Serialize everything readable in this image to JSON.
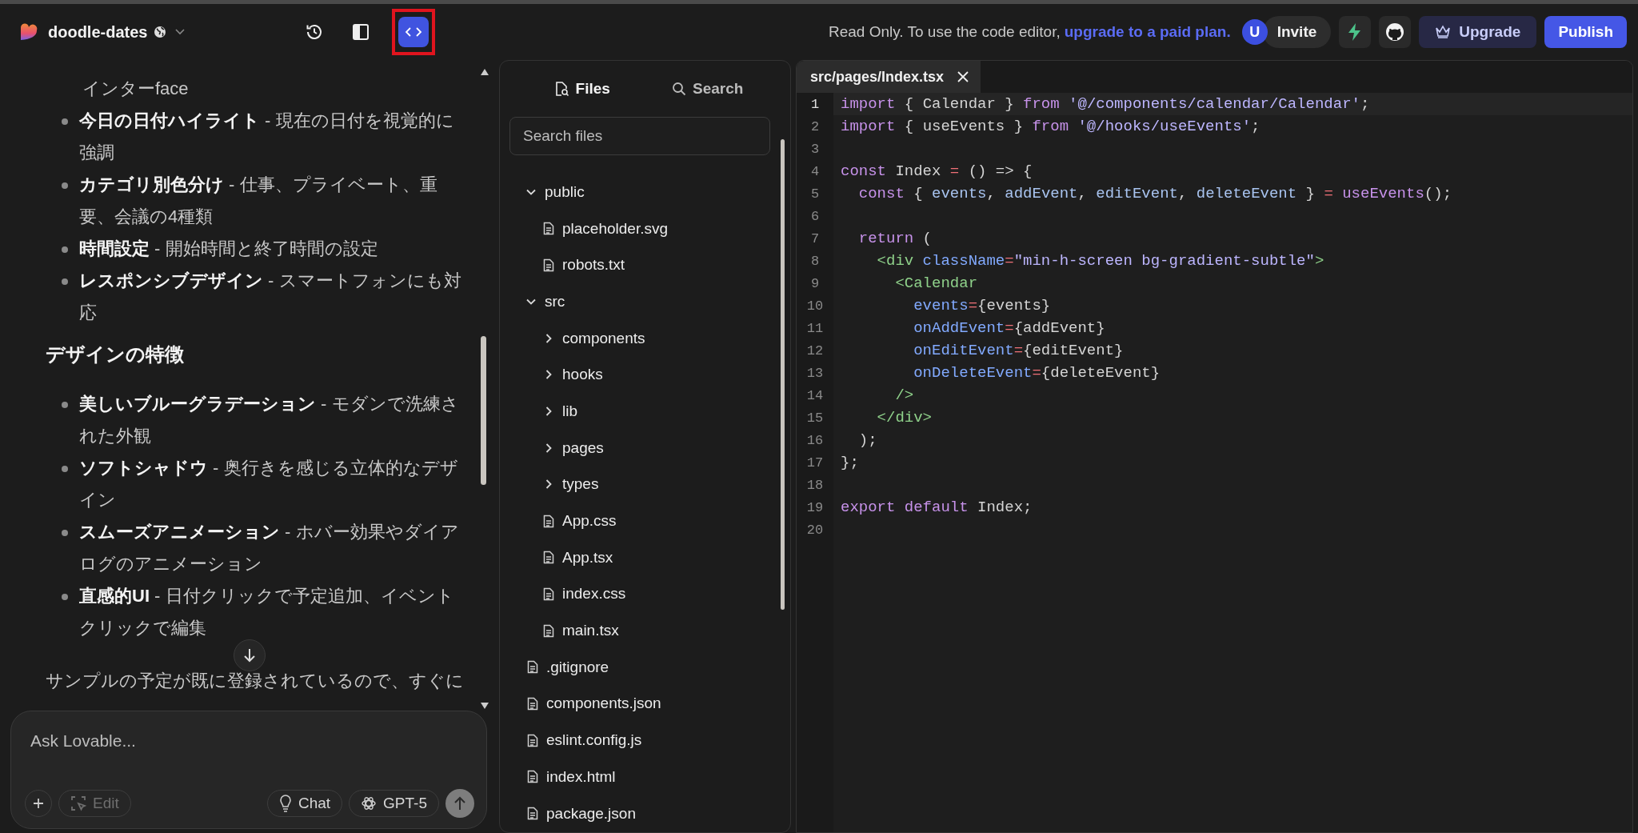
{
  "project": {
    "name": "doodle-dates"
  },
  "view_buttons": [
    {
      "kind": "history",
      "selected": false,
      "highlighted": false
    },
    {
      "kind": "sidebar",
      "selected": false,
      "highlighted": false
    },
    {
      "kind": "code",
      "selected": true,
      "highlighted": true
    }
  ],
  "notice": {
    "text": "Read Only. To use the code editor,",
    "link": "upgrade to a paid plan."
  },
  "avatar": {
    "initial": "U"
  },
  "invite": "Invite",
  "upgrade": "Upgrade",
  "publish": "Publish",
  "chat": {
    "features": [
      {
        "text": "インターface",
        "kind": "continuation"
      },
      {
        "text": "**今日の日付ハイライト** - 現在の日付を視覚的に強調",
        "kind": "bullet"
      },
      {
        "text": "**カテゴリ別色分け** - 仕事、プライベート、重要、会議の4種類",
        "kind": "bullet"
      },
      {
        "text": "**時間設定** - 開始時間と終了時間の設定",
        "kind": "bullet"
      },
      {
        "text": "**レスポンシブデザイン** - スマートフォンにも対応",
        "kind": "bullet"
      }
    ],
    "heading": "デザインの特徴",
    "design": [
      {
        "text": "**美しいブルーグラデーション** - モダンで洗練された外観",
        "kind": "bullet"
      },
      {
        "text": "**ソフトシャドウ** - 奥行きを感じる立体的なデザイン",
        "kind": "bullet"
      },
      {
        "text": "**スムーズアニメーション** - ホバー効果やダイアログのアニメーション",
        "kind": "bullet"
      },
      {
        "text": "**直感的UI** - 日付クリックで予定追加、イベントクリックで編集",
        "kind": "bullet"
      }
    ],
    "paragraph": "サンプルの予定が既に登録されているので、すぐに"
  },
  "composer": {
    "placeholder": "Ask Lovable...",
    "edit": {
      "label": "Edit",
      "disabled": true
    },
    "mode": "Chat",
    "model": "GPT-5",
    "send_disabled": true
  },
  "files_panel": {
    "tabs": [
      {
        "label": "Files",
        "selected": true
      },
      {
        "label": "Search",
        "selected": false
      }
    ],
    "search": {
      "placeholder": "Search files"
    },
    "tree": [
      {
        "name": "public",
        "kind": "folder",
        "expanded": true,
        "children": [
          {
            "name": "placeholder.svg",
            "kind": "file"
          },
          {
            "name": "robots.txt",
            "kind": "file"
          }
        ]
      },
      {
        "name": "src",
        "kind": "folder",
        "expanded": true,
        "children": [
          {
            "name": "components",
            "kind": "folder",
            "expanded": false
          },
          {
            "name": "hooks",
            "kind": "folder",
            "expanded": false
          },
          {
            "name": "lib",
            "kind": "folder",
            "expanded": false
          },
          {
            "name": "pages",
            "kind": "folder",
            "expanded": false
          },
          {
            "name": "types",
            "kind": "folder",
            "expanded": false
          },
          {
            "name": "App.css",
            "kind": "file"
          },
          {
            "name": "App.tsx",
            "kind": "file"
          },
          {
            "name": "index.css",
            "kind": "file"
          },
          {
            "name": "main.tsx",
            "kind": "file"
          }
        ]
      },
      {
        "name": ".gitignore",
        "kind": "file"
      },
      {
        "name": "components.json",
        "kind": "file"
      },
      {
        "name": "eslint.config.js",
        "kind": "file"
      },
      {
        "name": "index.html",
        "kind": "file"
      },
      {
        "name": "package.json",
        "kind": "file"
      }
    ]
  },
  "editor": {
    "tab": "src/pages/Index.tsx",
    "lines": [
      {
        "number": "1",
        "current": true,
        "tokens": [
          {
            "text": "import",
            "kind": "kw"
          },
          {
            "text": " { Calendar } ",
            "kind": "plain"
          },
          {
            "text": "from",
            "kind": "kw"
          },
          {
            "text": " '@/components/calendar/Calendar'",
            "kind": "str"
          },
          {
            "text": ";",
            "kind": "plain"
          }
        ]
      },
      {
        "number": "2",
        "current": false,
        "tokens": [
          {
            "text": "import",
            "kind": "kw"
          },
          {
            "text": " { useEvents } ",
            "kind": "plain"
          },
          {
            "text": "from",
            "kind": "kw"
          },
          {
            "text": " '@/hooks/useEvents'",
            "kind": "str"
          },
          {
            "text": ";",
            "kind": "plain"
          }
        ]
      },
      {
        "number": "3",
        "current": false
      },
      {
        "number": "4",
        "current": false,
        "tokens": [
          {
            "text": "const",
            "kind": "kw"
          },
          {
            "text": " Index ",
            "kind": "plain"
          },
          {
            "text": "=",
            "kind": "op"
          },
          {
            "text": " () => {",
            "kind": "plain"
          }
        ]
      },
      {
        "number": "5",
        "current": false,
        "tokens": [
          {
            "text": "  const",
            "kind": "kw"
          },
          {
            "text": " { ",
            "kind": "plain"
          },
          {
            "text": "events",
            "kind": "var"
          },
          {
            "text": ", ",
            "kind": "plain"
          },
          {
            "text": "addEvent",
            "kind": "var"
          },
          {
            "text": ", ",
            "kind": "plain"
          },
          {
            "text": "editEvent",
            "kind": "var"
          },
          {
            "text": ", ",
            "kind": "plain"
          },
          {
            "text": "deleteEvent",
            "kind": "var"
          },
          {
            "text": " } ",
            "kind": "plain"
          },
          {
            "text": "=",
            "kind": "op"
          },
          {
            "text": " useEvents",
            "kind": "fn"
          },
          {
            "text": "();",
            "kind": "plain"
          }
        ]
      },
      {
        "number": "6",
        "current": false
      },
      {
        "number": "7",
        "current": false,
        "tokens": [
          {
            "text": "  return",
            "kind": "kw"
          },
          {
            "text": " (",
            "kind": "plain"
          }
        ]
      },
      {
        "number": "8",
        "current": false,
        "tokens": [
          {
            "text": "    <div",
            "kind": "tag"
          },
          {
            "text": " className",
            "kind": "attr"
          },
          {
            "text": "=",
            "kind": "op"
          },
          {
            "text": "\"min-h-screen bg-gradient-subtle\"",
            "kind": "str"
          },
          {
            "text": ">",
            "kind": "tag"
          }
        ]
      },
      {
        "number": "9",
        "current": false,
        "tokens": [
          {
            "text": "      <Calendar",
            "kind": "tag"
          }
        ]
      },
      {
        "number": "10",
        "current": false,
        "tokens": [
          {
            "text": "        events",
            "kind": "attr"
          },
          {
            "text": "=",
            "kind": "op"
          },
          {
            "text": "{events}",
            "kind": "plain"
          }
        ]
      },
      {
        "number": "11",
        "current": false,
        "tokens": [
          {
            "text": "        onAddEvent",
            "kind": "attr"
          },
          {
            "text": "=",
            "kind": "op"
          },
          {
            "text": "{addEvent}",
            "kind": "plain"
          }
        ]
      },
      {
        "number": "12",
        "current": false,
        "tokens": [
          {
            "text": "        onEditEvent",
            "kind": "attr"
          },
          {
            "text": "=",
            "kind": "op"
          },
          {
            "text": "{editEvent}",
            "kind": "plain"
          }
        ]
      },
      {
        "number": "13",
        "current": false,
        "tokens": [
          {
            "text": "        onDeleteEvent",
            "kind": "attr"
          },
          {
            "text": "=",
            "kind": "op"
          },
          {
            "text": "{deleteEvent}",
            "kind": "plain"
          }
        ]
      },
      {
        "number": "14",
        "current": false,
        "tokens": [
          {
            "text": "      />",
            "kind": "tag"
          }
        ]
      },
      {
        "number": "15",
        "current": false,
        "tokens": [
          {
            "text": "    </div>",
            "kind": "tag"
          }
        ]
      },
      {
        "number": "16",
        "current": false,
        "tokens": [
          {
            "text": "  );",
            "kind": "plain"
          }
        ]
      },
      {
        "number": "17",
        "current": false,
        "tokens": [
          {
            "text": "};",
            "kind": "plain"
          }
        ]
      },
      {
        "number": "18",
        "current": false
      },
      {
        "number": "19",
        "current": false,
        "tokens": [
          {
            "text": "export default",
            "kind": "kw"
          },
          {
            "text": " Index;",
            "kind": "plain"
          }
        ]
      },
      {
        "number": "20",
        "current": false
      }
    ]
  }
}
